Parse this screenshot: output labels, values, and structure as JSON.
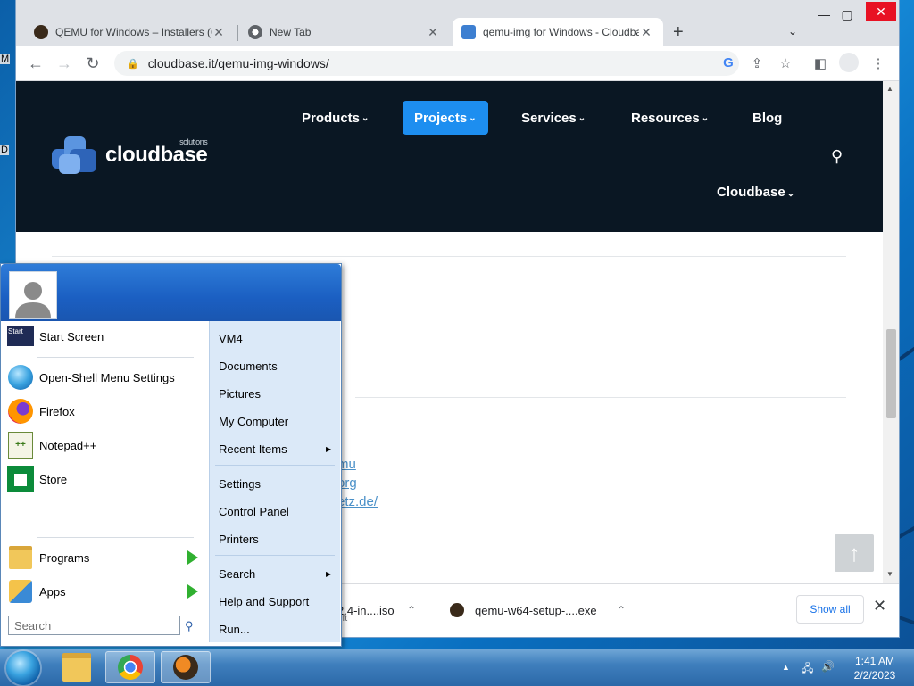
{
  "desktop": {
    "edge_labels": [
      "M",
      "D"
    ]
  },
  "browser": {
    "tabs": [
      {
        "label": "QEMU for Windows – Installers (6",
        "icon": "qemu-icon"
      },
      {
        "label": "New Tab",
        "icon": "chrome-icon"
      },
      {
        "label": "qemu-img for Windows - Cloudba",
        "icon": "cloudbase-icon",
        "active": true
      }
    ],
    "new_tab": "+",
    "url": "cloudbase.it/qemu-img-windows/"
  },
  "site": {
    "logo_text": "cloudbase",
    "logo_sub": "solutions",
    "nav": [
      "Products",
      "Projects",
      "Services",
      "Resources",
      "Blog"
    ],
    "active_nav": "Projects",
    "cloudbase_menu": "Cloudbase",
    "partial_links": [
      "mu",
      "org",
      "etz.de/",
      "/"
    ]
  },
  "downloads": {
    "items": [
      {
        "name": "2.4-in....iso",
        "sub": "eft"
      },
      {
        "name": "qemu-w64-setup-....exe"
      }
    ],
    "show_all": "Show all"
  },
  "start_menu": {
    "pinned": [
      "Start Screen",
      "Open-Shell Menu Settings",
      "Firefox",
      "Notepad++",
      "Store"
    ],
    "programs": "Programs",
    "apps": "Apps",
    "search_placeholder": "Search",
    "right": [
      "VM4",
      "Documents",
      "Pictures",
      "My Computer",
      "Recent Items",
      "Settings",
      "Control Panel",
      "Printers",
      "Search",
      "Help and Support",
      "Run..."
    ]
  },
  "taskbar": {
    "time": "1:41 AM",
    "date": "2/2/2023"
  },
  "colors": {
    "accent": "#1d8ef0",
    "site_header": "#0a1723",
    "start_menu_header": "#1b5fc2",
    "start_menu_right": "#dbe9f8"
  }
}
